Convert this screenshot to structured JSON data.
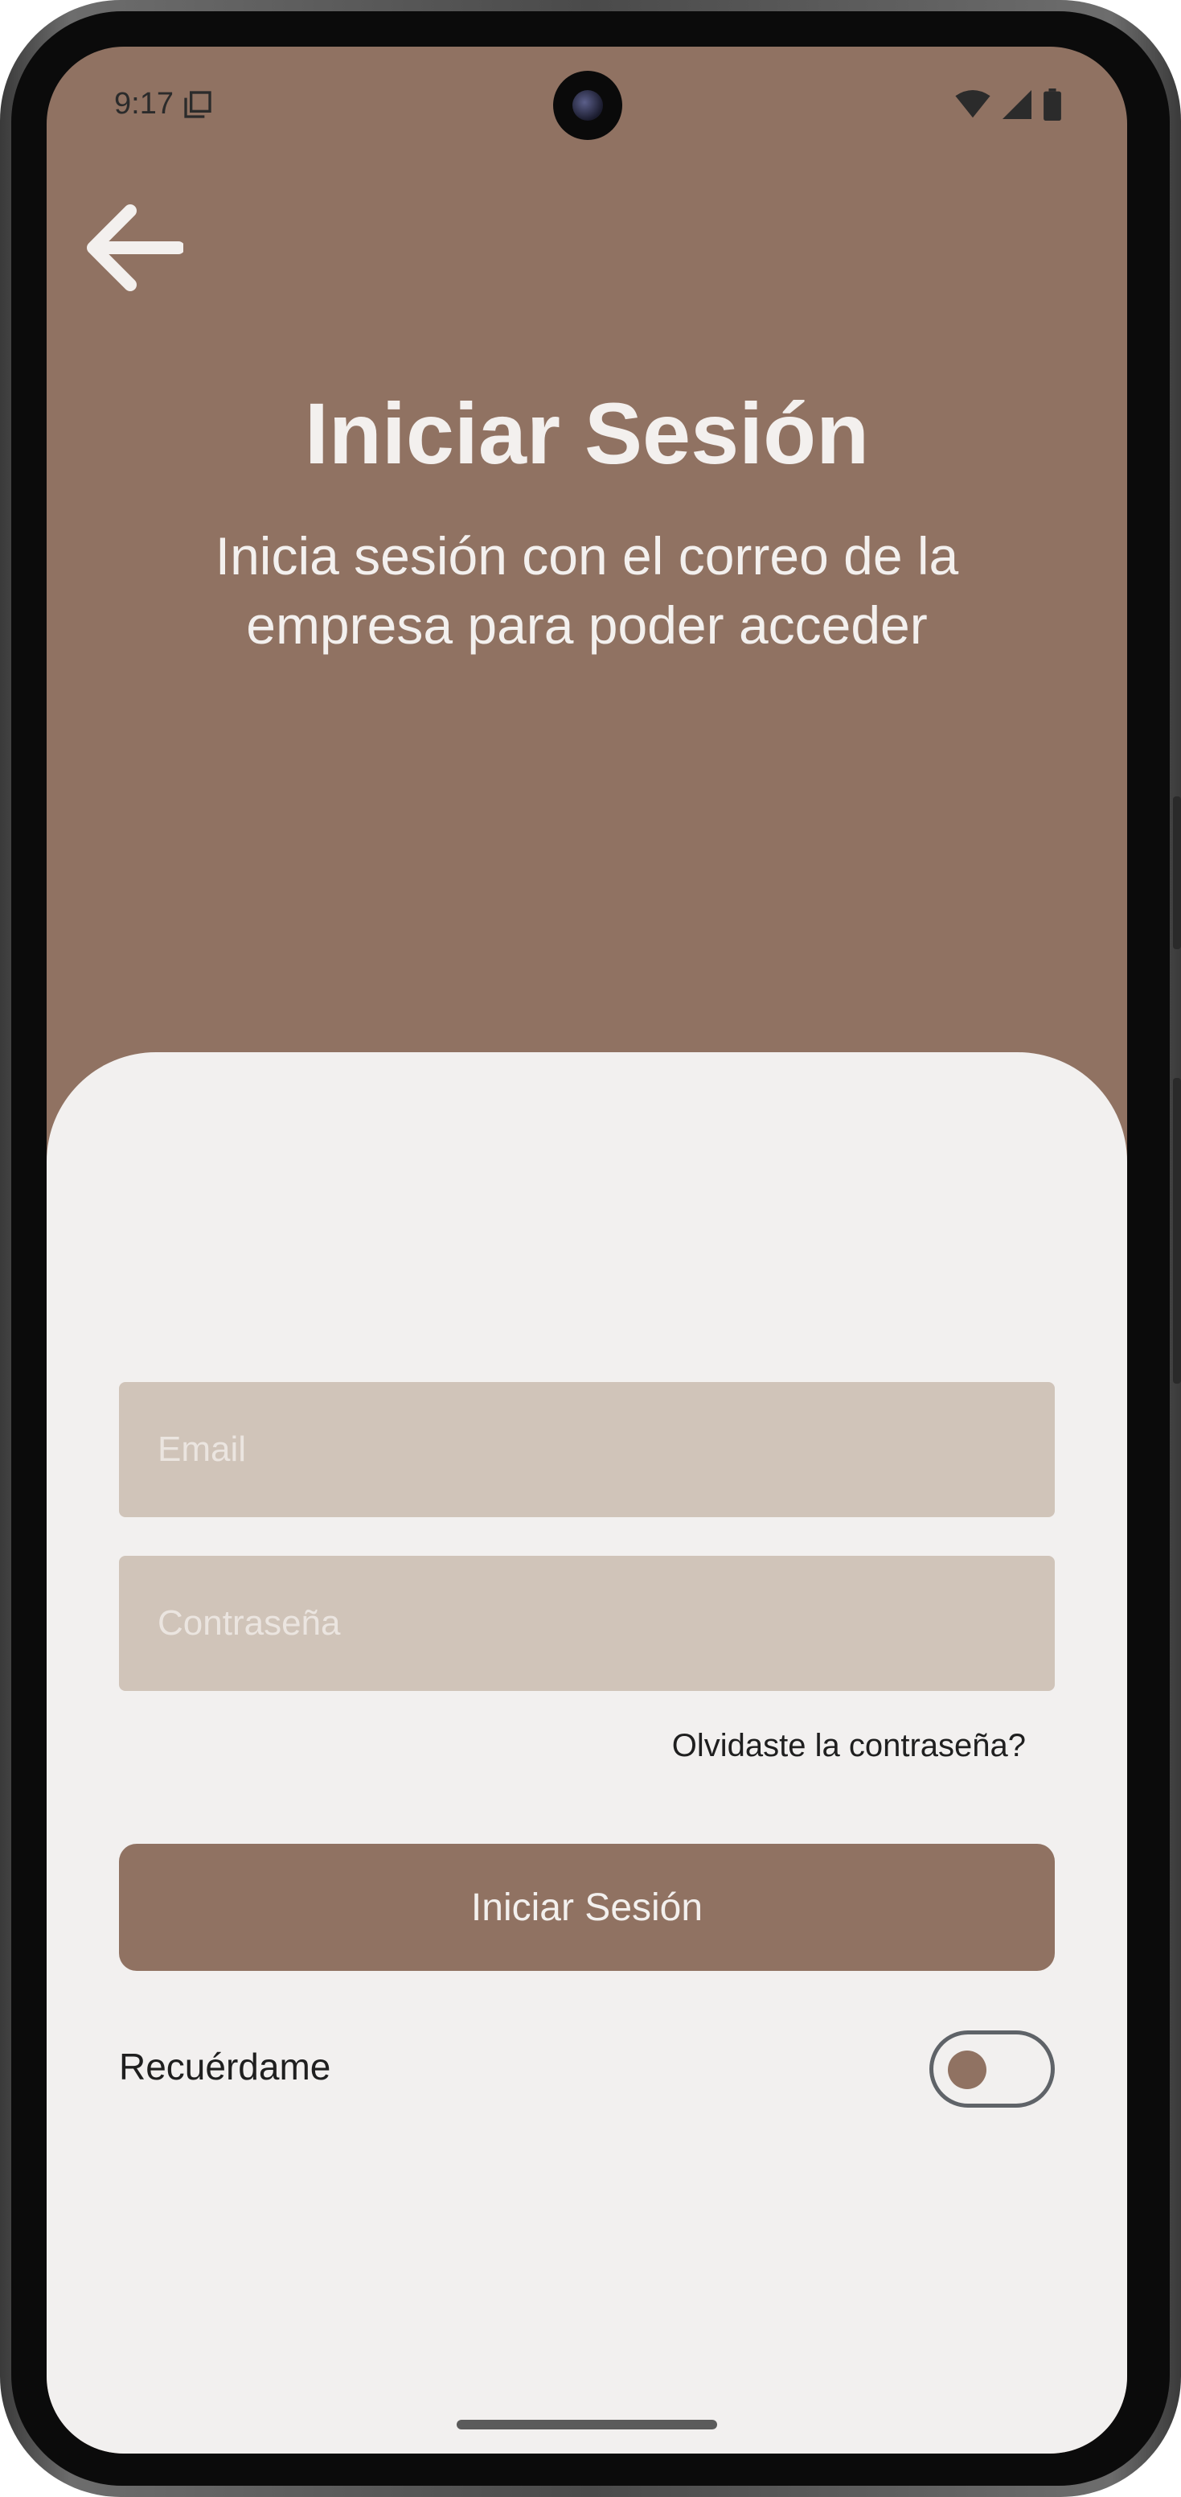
{
  "status_bar": {
    "time": "9:17",
    "icons": [
      "notification-copy-icon",
      "wifi-icon",
      "signal-icon",
      "battery-icon"
    ]
  },
  "header": {
    "back_icon": "arrow-left-icon",
    "title": "Iniciar Sesión",
    "subtitle_line1": "Inicia sesión con el correo de la",
    "subtitle_line2": "empresa para poder acceder"
  },
  "form": {
    "email_placeholder": "Email",
    "email_value": "",
    "password_placeholder": "Contraseña",
    "password_value": "",
    "forgot_password": "Olvidaste la contraseña?",
    "submit_label": "Iniciar Sesión",
    "remember_label": "Recuérdame",
    "remember_on": false
  },
  "colors": {
    "primary": "#907262",
    "sheet_background": "#f2f0ef",
    "field_background": "#d0c4b9",
    "on_primary_text": "#f3f0ee"
  }
}
